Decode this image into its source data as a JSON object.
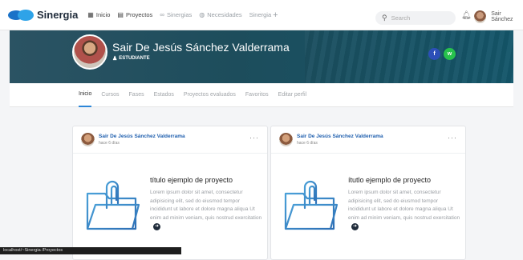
{
  "topbar": {
    "brand": "Sinergia",
    "nav": [
      {
        "icon": "grid-icon",
        "glyph": "▦",
        "label": "Inicio"
      },
      {
        "icon": "folder-icon",
        "glyph": "▤",
        "label": "Proyectos"
      },
      {
        "icon": "infinity-icon",
        "glyph": "∞",
        "label": "Sinergias"
      },
      {
        "icon": "globe-icon",
        "glyph": "◍",
        "label": "Necesidades"
      },
      {
        "icon": "plus-icon",
        "glyph": "+",
        "label": "Sinergia"
      }
    ],
    "search_placeholder": "Search",
    "user_name": "Sair Sánchez"
  },
  "profile": {
    "name": "Sair De Jesús Sánchez Valderrama",
    "role": "ESTUDIANTE",
    "social": {
      "facebook": "f",
      "whatsapp": "w"
    }
  },
  "tabs": [
    "Inicio",
    "Cursos",
    "Fases",
    "Estados",
    "Proyectos evaluados",
    "Favoritos",
    "Editar perfil"
  ],
  "cards": [
    {
      "author": "Sair De Jesús Sánchez Valderrama",
      "time": "hace 6 días",
      "title": "título ejemplo de proyecto",
      "text": "Lorem ipsum dolor sit amet, consectetur adipisicing elit, sed do eiusmod tempor incididunt ut labore et dolore magna aliqua Ut enim ad minim veniam, quis nostrud exercitation"
    },
    {
      "author": "Sair De Jesús Sánchez Valderrama",
      "time": "hace 6 días",
      "title": "ítutlo ejemplo de proyecto",
      "text": "Lorem ipsum dolor sit amet, consectetur adipisicing elit, sed do eiusmod tempor incididunt ut labore et dolore magna aliqua Ut enim ad minim veniam, quis nostrud exercitation"
    }
  ],
  "statusbar": "localhost/~Sinergia /Proyectos"
}
